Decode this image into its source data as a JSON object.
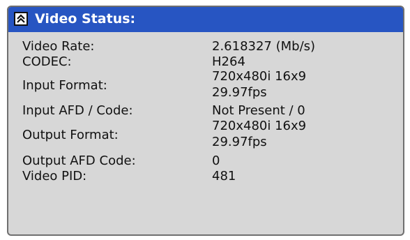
{
  "header": {
    "title": "Video Status:",
    "collapse_icon": "chevron-up-collapse-icon"
  },
  "rows": [
    {
      "label": "Video Rate:",
      "value": "2.618327 (Mb/s)"
    },
    {
      "label": "CODEC:",
      "value": "H264"
    },
    {
      "label": "Input Format:",
      "value_line1": "720x480i 16x9",
      "value_line2": "29.97fps"
    },
    {
      "label": "Input AFD / Code:",
      "value": "Not Present / 0"
    },
    {
      "label": "Output Format:",
      "value_line1": "720x480i 16x9",
      "value_line2": "29.97fps"
    },
    {
      "label": "Output AFD Code:",
      "value": "0"
    },
    {
      "label": "Video PID:",
      "value": "481"
    }
  ],
  "colors": {
    "header_bg": "#2755c2",
    "panel_bg": "#d7d7d7",
    "border": "#6f6f6f"
  }
}
